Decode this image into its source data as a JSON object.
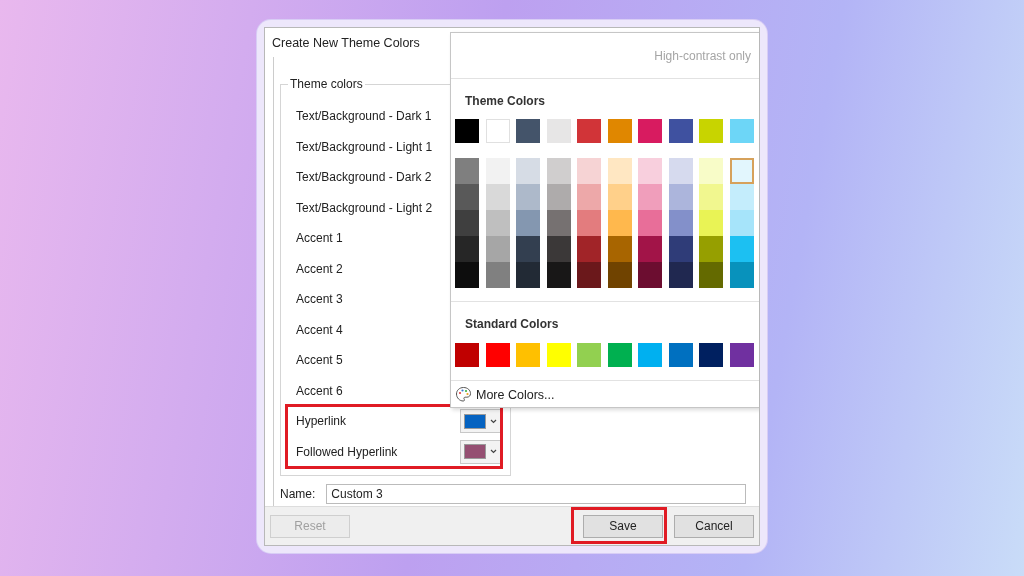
{
  "window": {
    "title": "Create New Theme Colors"
  },
  "group": {
    "title": "Theme colors",
    "rows": [
      {
        "label": "Text/Background - Dark 1"
      },
      {
        "label": "Text/Background - Light 1"
      },
      {
        "label": "Text/Background - Dark 2"
      },
      {
        "label": "Text/Background - Light 2"
      },
      {
        "label": "Accent 1"
      },
      {
        "label": "Accent 2"
      },
      {
        "label": "Accent 3"
      },
      {
        "label": "Accent 4"
      },
      {
        "label": "Accent 5"
      },
      {
        "label": "Accent 6"
      },
      {
        "label": "Hyperlink",
        "color": "#0563c1",
        "highlighted": true
      },
      {
        "label": "Followed Hyperlink",
        "color": "#954f72",
        "highlighted": true
      }
    ]
  },
  "name_field": {
    "label": "Name:",
    "value": "Custom 3"
  },
  "buttons": [
    {
      "label": "Reset",
      "disabled": true,
      "highlighted": false
    },
    {
      "label": "Save",
      "disabled": false,
      "highlighted": true
    },
    {
      "label": "Cancel",
      "disabled": false,
      "highlighted": false
    }
  ],
  "popup": {
    "high_contrast": {
      "label": "High-contrast only",
      "disabled": true
    },
    "theme_title": "Theme Colors",
    "theme_colors": [
      {
        "color": "#000000",
        "shades": [
          {
            "color": "#7f7f7f",
            "selected": false
          },
          {
            "color": "#595959",
            "selected": false
          },
          {
            "color": "#3f3f3f",
            "selected": false
          },
          {
            "color": "#262626",
            "selected": false
          },
          {
            "color": "#0d0d0d",
            "selected": false
          }
        ]
      },
      {
        "color": "#ffffff",
        "shades": [
          {
            "color": "#f2f2f2",
            "selected": false
          },
          {
            "color": "#d9d9d9",
            "selected": false
          },
          {
            "color": "#bfbfbf",
            "selected": false
          },
          {
            "color": "#a6a6a6",
            "selected": false
          },
          {
            "color": "#808080",
            "selected": false
          }
        ]
      },
      {
        "color": "#44546a",
        "shades": [
          {
            "color": "#d6dce5",
            "selected": false
          },
          {
            "color": "#adb9ca",
            "selected": false
          },
          {
            "color": "#8497b0",
            "selected": false
          },
          {
            "color": "#333f50",
            "selected": false
          },
          {
            "color": "#222a35",
            "selected": false
          }
        ]
      },
      {
        "color": "#e7e6e6",
        "shades": [
          {
            "color": "#d0cece",
            "selected": false
          },
          {
            "color": "#aeabab",
            "selected": false
          },
          {
            "color": "#767171",
            "selected": false
          },
          {
            "color": "#3b3838",
            "selected": false
          },
          {
            "color": "#181717",
            "selected": false
          }
        ]
      },
      {
        "color": "#d13438",
        "shades": [
          {
            "color": "#f6d3d4",
            "selected": false
          },
          {
            "color": "#eda8a9",
            "selected": false
          },
          {
            "color": "#e37c7e",
            "selected": false
          },
          {
            "color": "#a12428",
            "selected": false
          },
          {
            "color": "#6b181b",
            "selected": false
          }
        ]
      },
      {
        "color": "#e08700",
        "shades": [
          {
            "color": "#ffe7c2",
            "selected": false
          },
          {
            "color": "#ffd08a",
            "selected": false
          },
          {
            "color": "#ffb84d",
            "selected": false
          },
          {
            "color": "#a86500",
            "selected": false
          },
          {
            "color": "#704300",
            "selected": false
          }
        ]
      },
      {
        "color": "#d81b60",
        "shades": [
          {
            "color": "#f8cfdd",
            "selected": false
          },
          {
            "color": "#f09ebb",
            "selected": false
          },
          {
            "color": "#e86e99",
            "selected": false
          },
          {
            "color": "#a21448",
            "selected": false
          },
          {
            "color": "#6c0d30",
            "selected": false
          }
        ]
      },
      {
        "color": "#3f51a0",
        "shades": [
          {
            "color": "#d6daee",
            "selected": false
          },
          {
            "color": "#acb5dc",
            "selected": false
          },
          {
            "color": "#8390ca",
            "selected": false
          },
          {
            "color": "#2f3c78",
            "selected": false
          },
          {
            "color": "#202850",
            "selected": false
          }
        ]
      },
      {
        "color": "#c8d400",
        "shades": [
          {
            "color": "#f8fcc8",
            "selected": false
          },
          {
            "color": "#f1f78f",
            "selected": false
          },
          {
            "color": "#e9f355",
            "selected": false
          },
          {
            "color": "#969f00",
            "selected": false
          },
          {
            "color": "#646a00",
            "selected": false
          }
        ]
      },
      {
        "color": "#6dd6f7",
        "shades": [
          {
            "color": "#e2f6fd",
            "selected": true
          },
          {
            "color": "#c4edfc",
            "selected": false
          },
          {
            "color": "#a6e4fa",
            "selected": false
          },
          {
            "color": "#1cc0f2",
            "selected": false
          },
          {
            "color": "#0892bc",
            "selected": false
          }
        ]
      }
    ],
    "standard_title": "Standard Colors",
    "standard_colors": [
      {
        "color": "#c00000"
      },
      {
        "color": "#ff0000"
      },
      {
        "color": "#ffc000"
      },
      {
        "color": "#ffff00"
      },
      {
        "color": "#92d050"
      },
      {
        "color": "#00b050"
      },
      {
        "color": "#00b0f0"
      },
      {
        "color": "#0070c0"
      },
      {
        "color": "#002060"
      },
      {
        "color": "#7030a0"
      }
    ],
    "more": "More Colors..."
  }
}
